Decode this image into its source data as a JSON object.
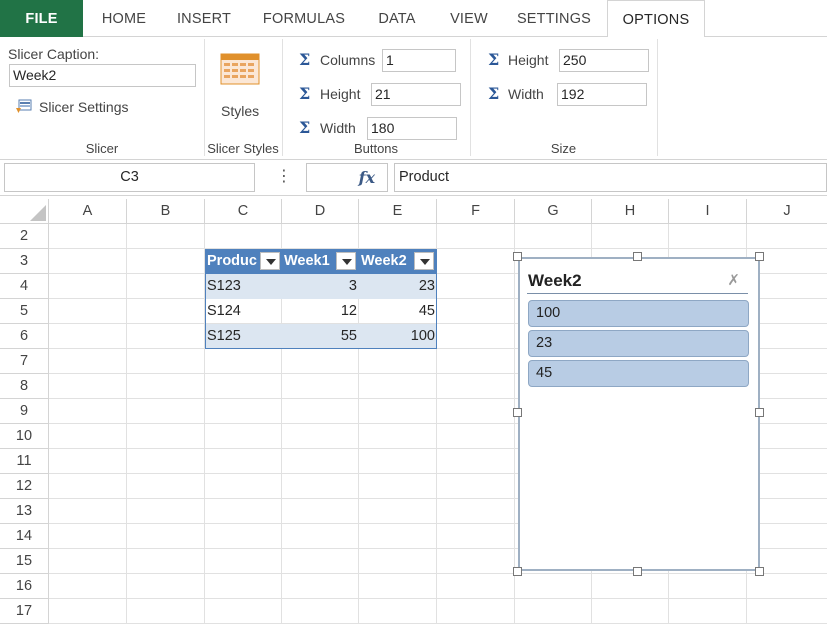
{
  "tabs": [
    {
      "label": "FILE"
    },
    {
      "label": "HOME"
    },
    {
      "label": "INSERT"
    },
    {
      "label": "FORMULAS"
    },
    {
      "label": "DATA"
    },
    {
      "label": "VIEW"
    },
    {
      "label": "SETTINGS"
    },
    {
      "label": "OPTIONS"
    }
  ],
  "ribbon": {
    "slicer": {
      "caption_label": "Slicer Caption:",
      "caption_value": "Week2",
      "settings_label": "Slicer Settings",
      "group_label": "Slicer"
    },
    "styles": {
      "button_label": "Styles",
      "group_label": "Slicer Styles"
    },
    "buttons": {
      "columns_label": "Columns",
      "columns_value": "1",
      "height_label": "Height",
      "height_value": "21",
      "width_label": "Width",
      "width_value": "180",
      "group_label": "Buttons"
    },
    "size": {
      "height_label": "Height",
      "height_value": "250",
      "width_label": "Width",
      "width_value": "192",
      "group_label": "Size"
    }
  },
  "formula_bar": {
    "name_box": "C3",
    "more_icon": "⋮",
    "fx": "fx",
    "formula": "Product"
  },
  "columns": [
    "A",
    "B",
    "C",
    "D",
    "E",
    "F",
    "G",
    "H",
    "I",
    "J"
  ],
  "rows": [
    "2",
    "3",
    "4",
    "5",
    "6",
    "7",
    "8",
    "9",
    "10",
    "11",
    "12",
    "13",
    "14",
    "15",
    "16",
    "17"
  ],
  "table": {
    "headers": [
      "Produc",
      "Week1",
      "Week2"
    ],
    "rows": [
      [
        "S123",
        "3",
        "23"
      ],
      [
        "S124",
        "12",
        "45"
      ],
      [
        "S125",
        "55",
        "100"
      ]
    ]
  },
  "slicer": {
    "title": "Week2",
    "clear_icon": "✗",
    "items": [
      "100",
      "23",
      "45"
    ]
  },
  "colors": {
    "file_tab": "#217346",
    "table_header": "#4f81bd",
    "table_band": "#dce6f1",
    "slicer_item": "#b8cce4",
    "sigma": "#2b5797"
  }
}
